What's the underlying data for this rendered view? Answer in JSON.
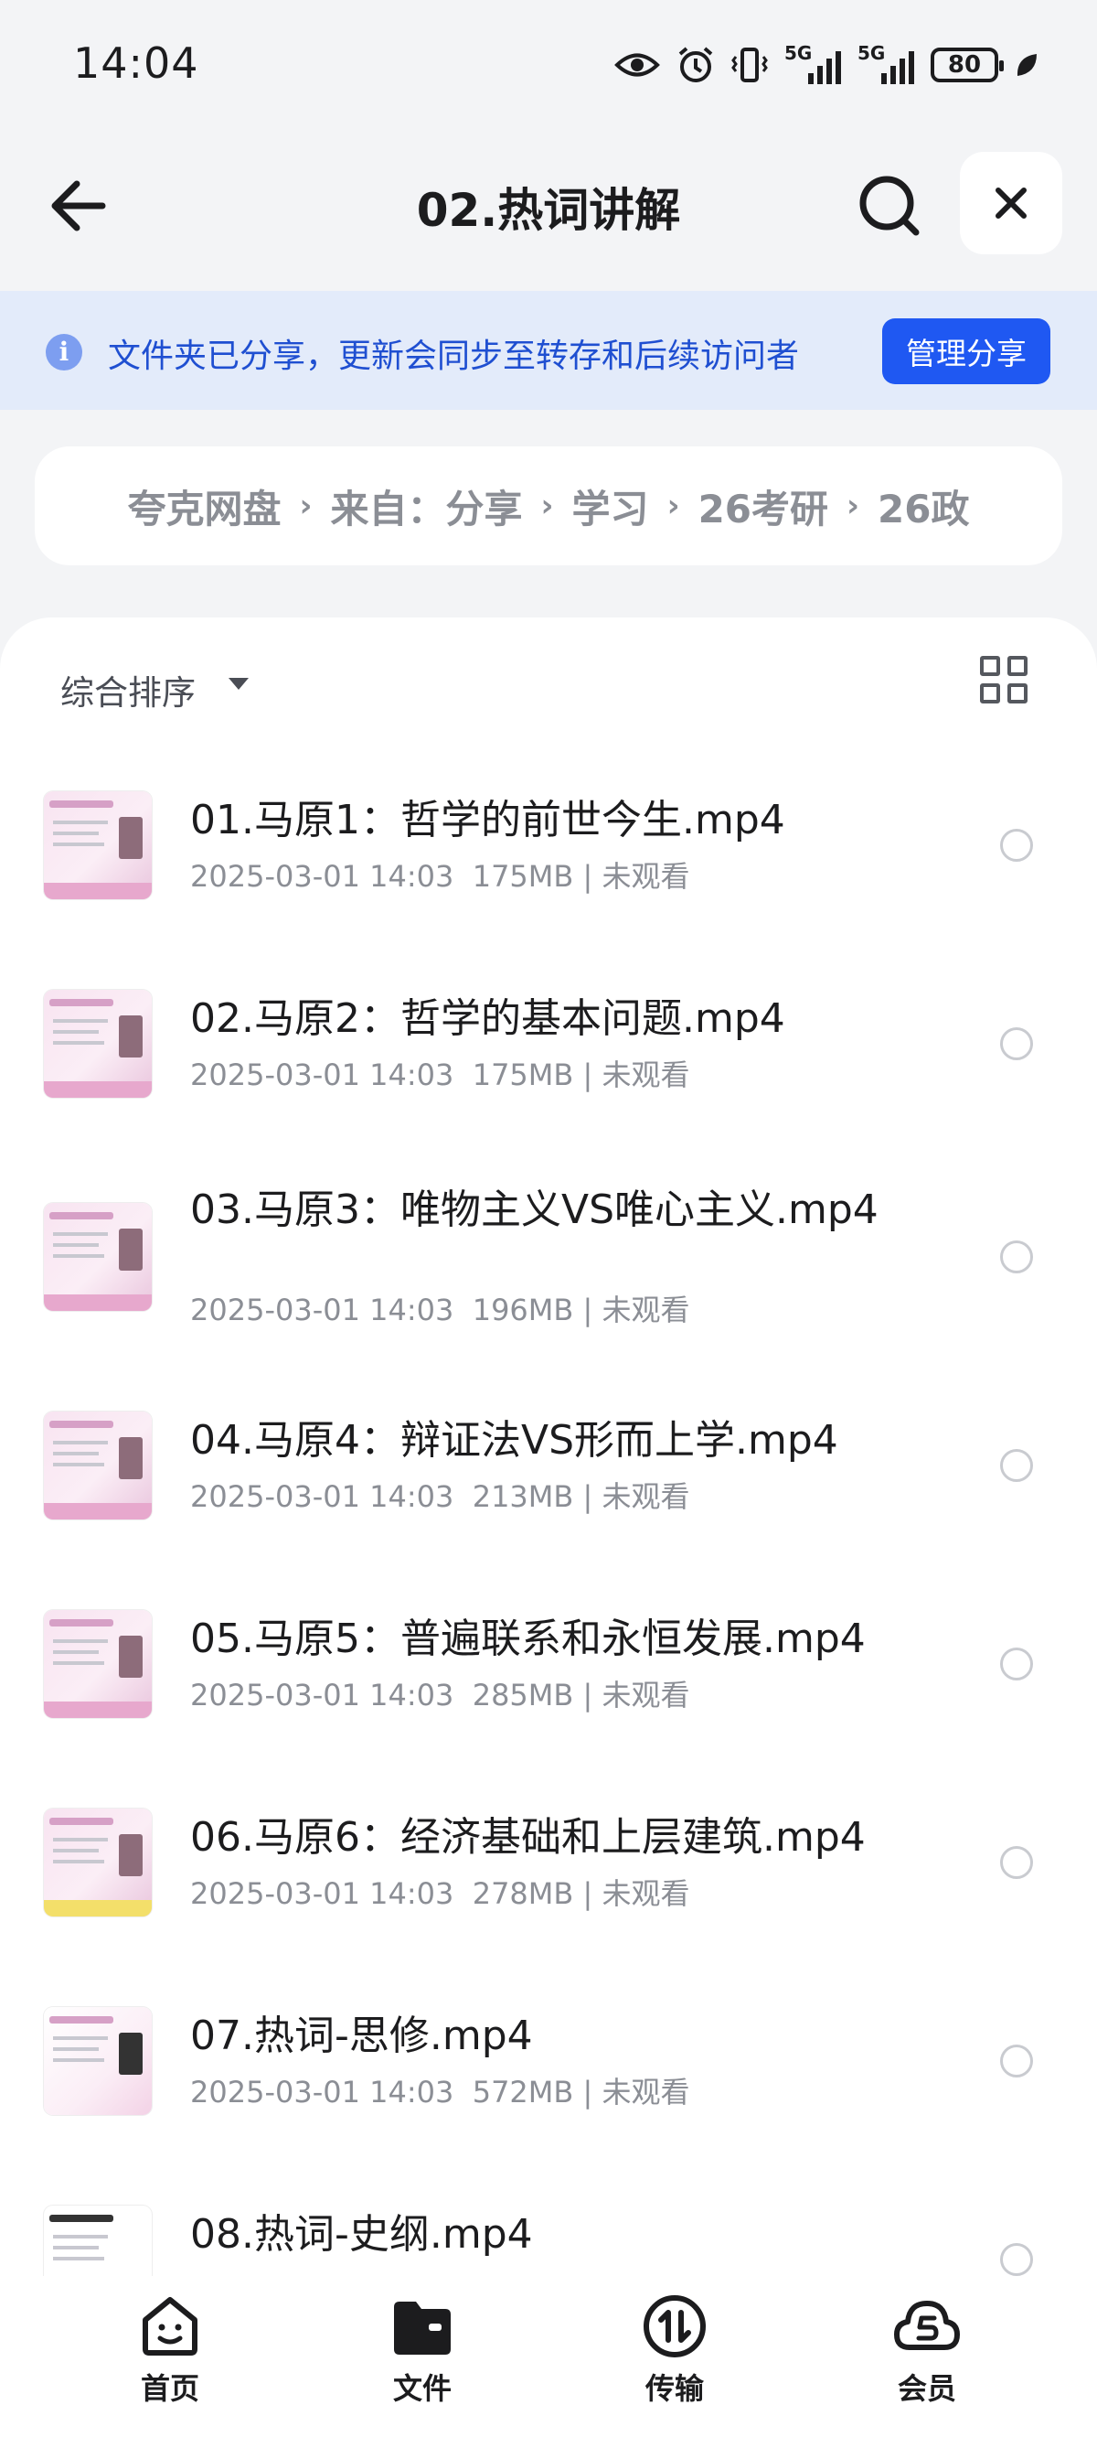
{
  "status": {
    "time": "14:04",
    "network1": "5G",
    "network2": "5G",
    "battery": "80"
  },
  "header": {
    "title": "02.热词讲解"
  },
  "notice": {
    "text": "文件夹已分享，更新会同步至转存和后续访问者",
    "button": "管理分享"
  },
  "breadcrumb": [
    "夸克网盘",
    "来自：分享",
    "学习",
    "26考研",
    "26政"
  ],
  "sort": {
    "label": "综合排序"
  },
  "files": [
    {
      "name": "01.马原1：哲学的前世今生.mp4",
      "date": "2025-03-01 14:03",
      "size": "175MB",
      "status": "未观看"
    },
    {
      "name": "02.马原2：哲学的基本问题.mp4",
      "date": "2025-03-01 14:03",
      "size": "175MB",
      "status": "未观看"
    },
    {
      "name": "03.马原3：唯物主义VS唯心主义.mp4",
      "date": "2025-03-01 14:03",
      "size": "196MB",
      "status": "未观看"
    },
    {
      "name": "04.马原4：辩证法VS形而上学.mp4",
      "date": "2025-03-01 14:03",
      "size": "213MB",
      "status": "未观看"
    },
    {
      "name": "05.马原5：普遍联系和永恒发展.mp4",
      "date": "2025-03-01 14:03",
      "size": "285MB",
      "status": "未观看"
    },
    {
      "name": "06.马原6：经济基础和上层建筑.mp4",
      "date": "2025-03-01 14:03",
      "size": "278MB",
      "status": "未观看"
    },
    {
      "name": "07.热词-思修.mp4",
      "date": "2025-03-01 14:03",
      "size": "572MB",
      "status": "未观看"
    },
    {
      "name": "08.热词-史纲.mp4",
      "date": "",
      "size": "",
      "status": ""
    }
  ],
  "tabs": [
    {
      "label": "首页",
      "icon": "home-face-icon"
    },
    {
      "label": "文件",
      "icon": "folder-icon"
    },
    {
      "label": "传输",
      "icon": "transfer-icon"
    },
    {
      "label": "会员",
      "icon": "cloud-vip-icon"
    }
  ]
}
